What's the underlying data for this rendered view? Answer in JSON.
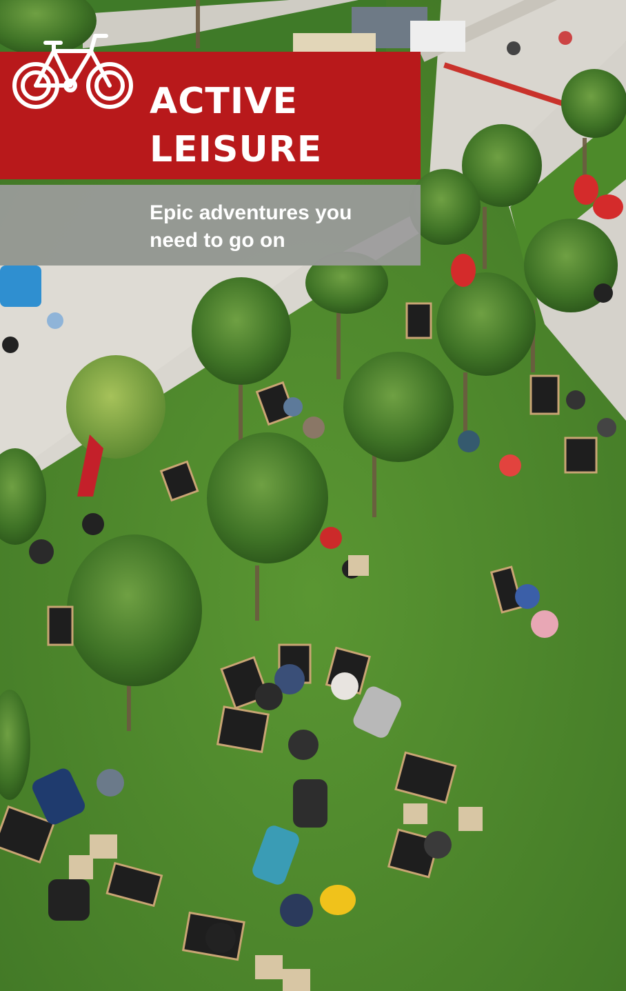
{
  "banner": {
    "title": "ACTIVE\nLEISURE",
    "subtitle": "Epic adventures you\nneed to go on",
    "icon": "bicycle-icon",
    "accent_color": "#b8191b",
    "subtitle_bg": "#9b9b9b"
  },
  "photo": {
    "subject": "aerial-park-lawn-with-deckchairs",
    "grass_color": "#4f8a2c",
    "path_color": "#d9d6cf"
  }
}
